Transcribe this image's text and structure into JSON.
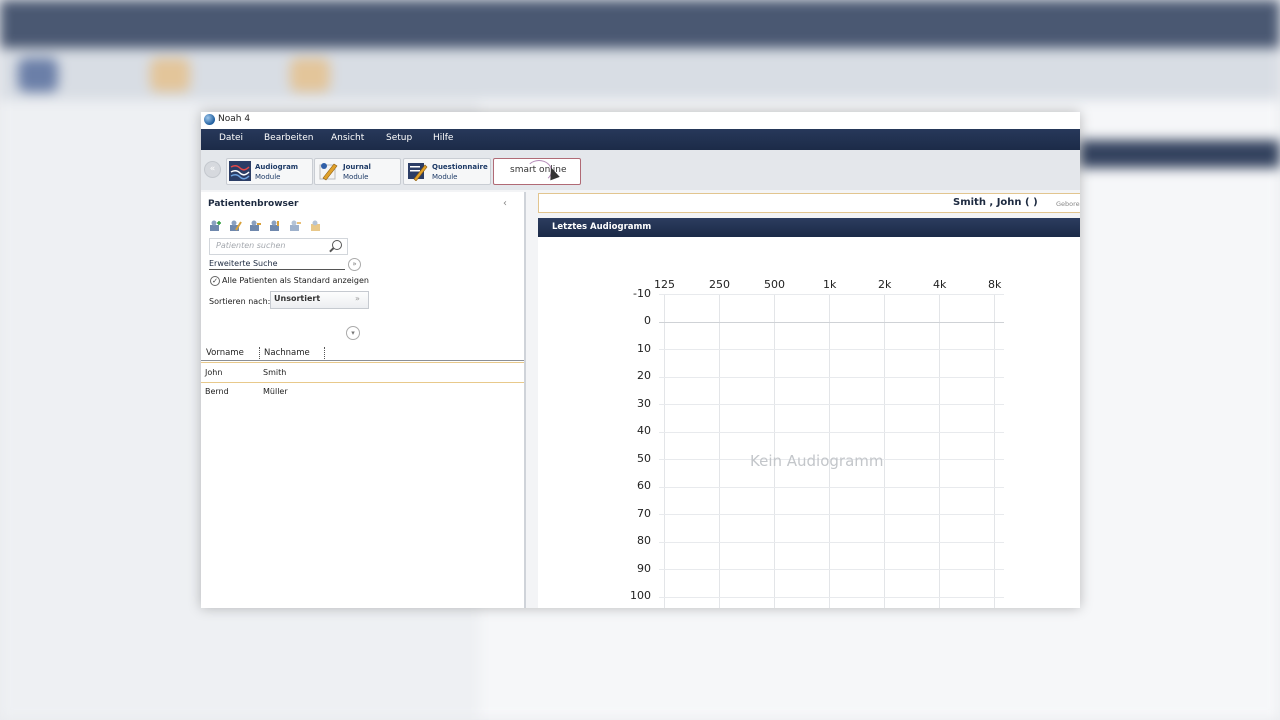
{
  "window": {
    "title": "Noah 4"
  },
  "menu": [
    "Datei",
    "Bearbeiten",
    "Ansicht",
    "Setup",
    "Hilfe"
  ],
  "modules": [
    {
      "name": "Audiogram",
      "sub": "Module"
    },
    {
      "name": "Journal",
      "sub": "Module"
    },
    {
      "name": "Questionnaire",
      "sub": "Module"
    }
  ],
  "smart_button": {
    "label": "smart online"
  },
  "patient_browser": {
    "title": "Patientenbrowser",
    "search_placeholder": "Patienten suchen",
    "advanced_search": "Erweiterte Suche",
    "show_all_label": "Alle Patienten als Standard anzeigen",
    "sort_label": "Sortieren nach:",
    "sort_value": "Unsortiert",
    "columns": [
      "Vorname",
      "Nachname"
    ],
    "patients": [
      {
        "first": "John",
        "last": "Smith"
      },
      {
        "first": "Bernd",
        "last": "Müller"
      }
    ]
  },
  "patient_bar": {
    "name": "Smith , John  (  )",
    "born_label": "Gebore"
  },
  "audiogram": {
    "title": "Letztes Audiogramm",
    "frequencies": [
      "125",
      "250",
      "500",
      "1k",
      "2k",
      "4k",
      "8k"
    ],
    "db_levels": [
      "-10",
      "0",
      "10",
      "20",
      "30",
      "40",
      "50",
      "60",
      "70",
      "80",
      "90",
      "100"
    ],
    "empty_text": "Kein Audiogramm"
  },
  "colors": {
    "menubar": "#1c2b48",
    "accent_border": "#e2c58f",
    "smart_border": "#b06a75"
  }
}
